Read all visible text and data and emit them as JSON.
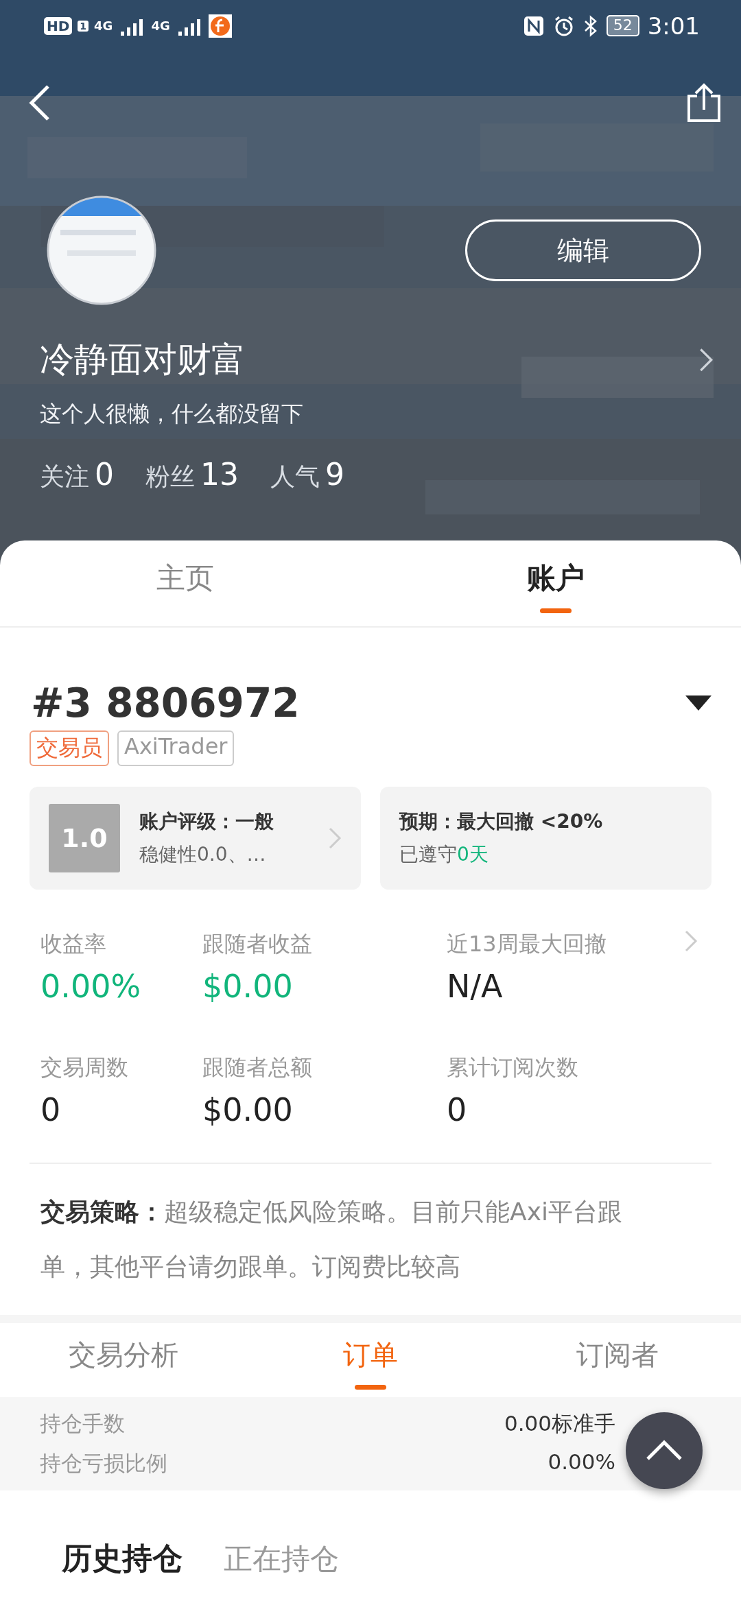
{
  "status_bar": {
    "hd": "HD",
    "sim": "1",
    "network_1": "4G",
    "network_2": "4G",
    "battery": "52",
    "time": "3:01"
  },
  "header": {
    "name": "冷静面对财富",
    "bio": "这个人很懒，什么都没留下",
    "edit_button": "编辑",
    "stats": [
      {
        "label": "关注",
        "value": "0"
      },
      {
        "label": "粉丝",
        "value": "13"
      },
      {
        "label": "人气",
        "value": "9"
      }
    ]
  },
  "main_tabs": [
    {
      "label": "主页",
      "selected": false
    },
    {
      "label": "账户",
      "selected": true
    }
  ],
  "account": {
    "number": "#3 8806972",
    "tags": [
      {
        "label": "交易员",
        "kind": "role"
      },
      {
        "label": "AxiTrader",
        "kind": "broker"
      }
    ],
    "rating_card": {
      "score": "1.0",
      "title": "账户评级：一般",
      "subtitle": "稳健性0.0、…"
    },
    "expectation_card": {
      "title": "预期：最大回撤 <20%",
      "kept_prefix": "已遵守",
      "kept_value": "0天"
    },
    "metrics": [
      {
        "label": "收益率",
        "value": "0.00%",
        "highlight": true
      },
      {
        "label": "跟随者收益",
        "value": "$0.00",
        "highlight": true
      },
      {
        "label": "近13周最大回撤",
        "value": "N/A",
        "highlight": false
      },
      {
        "label": "交易周数",
        "value": "0",
        "highlight": false
      },
      {
        "label": "跟随者总额",
        "value": "$0.00",
        "highlight": false
      },
      {
        "label": "累计订阅次数",
        "value": "0",
        "highlight": false
      }
    ],
    "strategy": "**交易策略：**超级稳定低风险策略。目前只能Axi平台跟单，其他平台请勿跟单。订阅费比较高"
  },
  "sub_tabs": [
    {
      "label": "交易分析",
      "selected": false
    },
    {
      "label": "订单",
      "selected": true
    },
    {
      "label": "订阅者",
      "selected": false
    }
  ],
  "summary": [
    {
      "label": "持仓手数",
      "value": "0.00标准手"
    },
    {
      "label": "持仓亏损比例",
      "value": "0.00%"
    }
  ],
  "position_tabs": [
    {
      "label": "历史持仓",
      "selected": true
    },
    {
      "label": "正在持仓",
      "selected": false
    }
  ]
}
